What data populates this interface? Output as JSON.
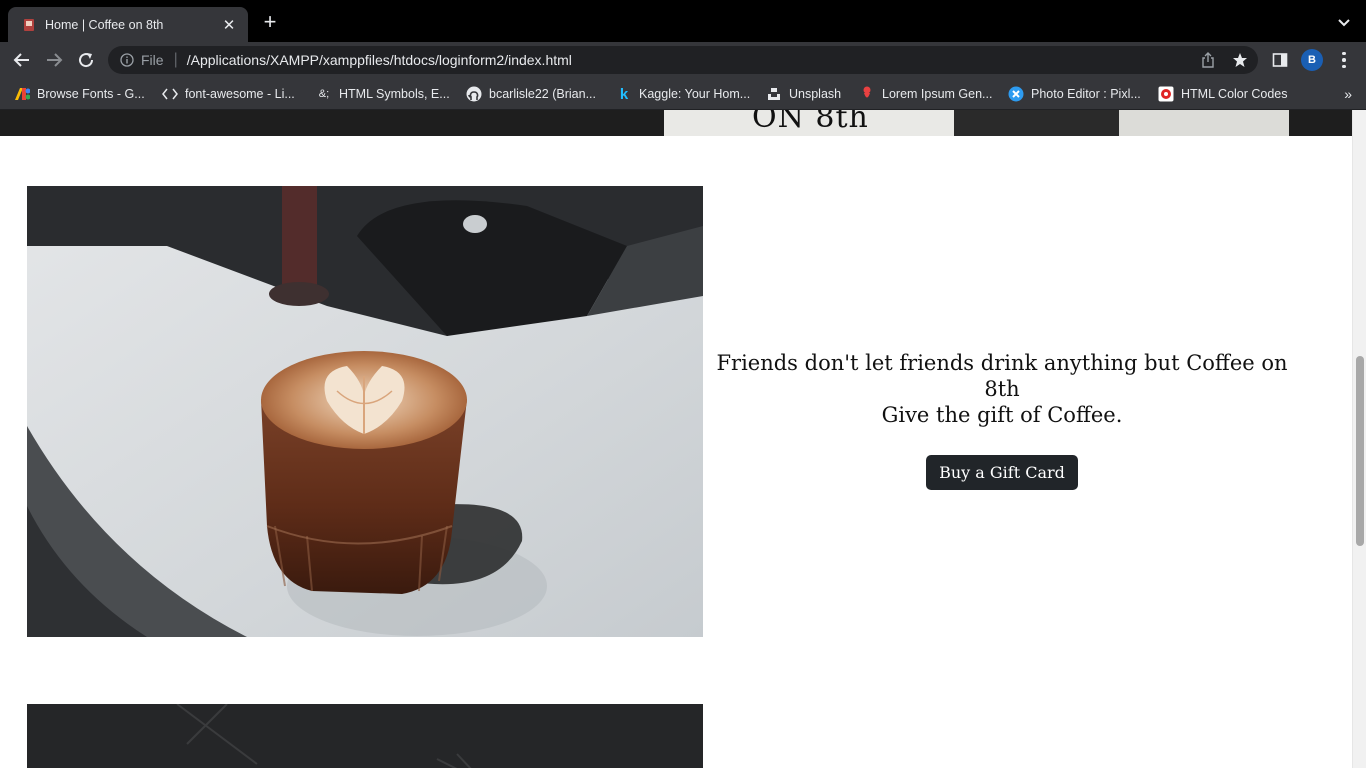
{
  "browser": {
    "tab": {
      "title": "Home | Coffee on 8th",
      "favicon": "coffee-favicon-icon"
    },
    "omnibox": {
      "scheme_label": "File",
      "url": "/Applications/XAMPP/xamppfiles/htdocs/loginform2/index.html"
    },
    "profile_initial": "B",
    "bookmarks": [
      {
        "label": "Browse Fonts - G...",
        "icon": "google-fonts-icon"
      },
      {
        "label": "font-awesome - Li...",
        "icon": "code-icon"
      },
      {
        "label": "HTML Symbols, E...",
        "icon": "ampersand-icon"
      },
      {
        "label": "bcarlisle22 (Brian...",
        "icon": "github-icon"
      },
      {
        "label": "Kaggle: Your Hom...",
        "icon": "kaggle-icon"
      },
      {
        "label": "Unsplash",
        "icon": "unsplash-icon"
      },
      {
        "label": "Lorem Ipsum Gen...",
        "icon": "lorem-ipsum-icon"
      },
      {
        "label": "Photo Editor : Pixl...",
        "icon": "pixlr-icon"
      },
      {
        "label": "HTML Color Codes",
        "icon": "color-codes-icon"
      }
    ],
    "bookmarks_overflow": "»"
  },
  "page": {
    "hero_sign_text": "ON 8th",
    "promo": {
      "line1": "Friends don't let friends drink anything but Coffee on 8th",
      "line2": "Give the gift of Coffee.",
      "button_label": "Buy a Gift Card"
    },
    "colors": {
      "button_bg": "#212529",
      "chrome_dark": "#35363a",
      "tabstrip": "#000000"
    }
  }
}
